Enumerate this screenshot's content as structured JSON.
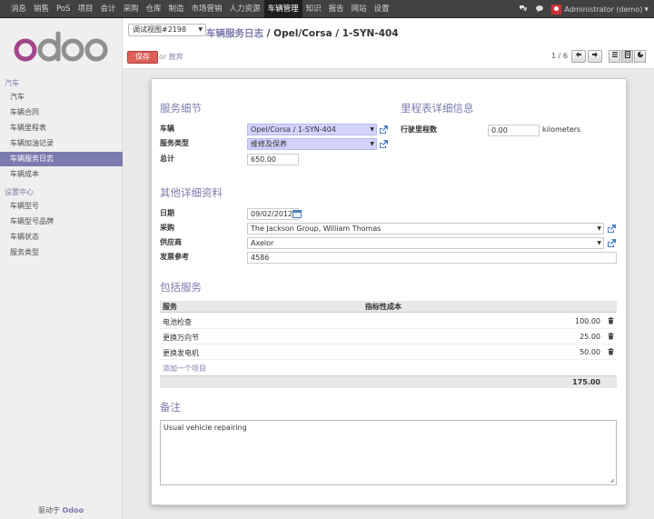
{
  "topmenu": [
    "消息",
    "销售",
    "PoS",
    "项目",
    "会计",
    "采购",
    "仓库",
    "制造",
    "市场营销",
    "人力资源",
    "车辆管理",
    "知识",
    "报告",
    "网站",
    "设置"
  ],
  "topmenu_active_index": 10,
  "user": {
    "name": "Administrator (demo)"
  },
  "sidebar": {
    "section1": "汽车",
    "items1": [
      "汽车",
      "车辆合同",
      "车辆里程表",
      "车辆加油记录",
      "车辆服务日志",
      "车辆成本"
    ],
    "active_item": "车辆服务日志",
    "section2": "设置中心",
    "items2": [
      "车辆型号",
      "车辆型号品牌",
      "车辆状态",
      "服务类型"
    ],
    "powered_prefix": "驱动于",
    "powered_brand": "Odoo"
  },
  "control_panel": {
    "debug_view": "调试视图#2198",
    "breadcrumb_parent": "车辆服务日志",
    "breadcrumb_sep": " / ",
    "breadcrumb_current": "Opel/Corsa / 1-SYN-404",
    "save_label": "保存",
    "or_label": "or",
    "discard_label": "放弃",
    "pager": "1 / 6"
  },
  "form": {
    "service_details_title": "服务细节",
    "vehicle_label": "车辆",
    "vehicle_value": "Opel/Corsa / 1-SYN-404",
    "service_type_label": "服务类型",
    "service_type_value": "维修及保养",
    "total_label": "总计",
    "total_value": "650.00",
    "odometer_title": "里程表详细信息",
    "odometer_label": "行驶里程数",
    "odometer_value": "0.00",
    "odometer_unit": "kilometers",
    "other_details_title": "其他详细资料",
    "date_label": "日期",
    "date_value": "09/02/2012",
    "purchaser_label": "采购",
    "purchaser_value": "The Jackson Group, William Thomas",
    "vendor_label": "供应商",
    "vendor_value": "Axelor",
    "invoice_ref_label": "发票参考",
    "invoice_ref_value": "4586",
    "included_services_title": "包括服务",
    "table_headers": [
      "服务",
      "指标性成本"
    ],
    "table_rows": [
      {
        "service": "电池检查",
        "cost": "100.00"
      },
      {
        "service": "更换万向节",
        "cost": "25.00"
      },
      {
        "service": "更换发电机",
        "cost": "50.00"
      }
    ],
    "add_item_label": "添加一个项目",
    "table_total": "175.00",
    "notes_title": "备注",
    "notes_value": "Usual vehicle repairing"
  },
  "colors": {
    "accent": "#7c7bad",
    "save_button": "#dc5f59",
    "required_field": "#d2d2ff"
  }
}
